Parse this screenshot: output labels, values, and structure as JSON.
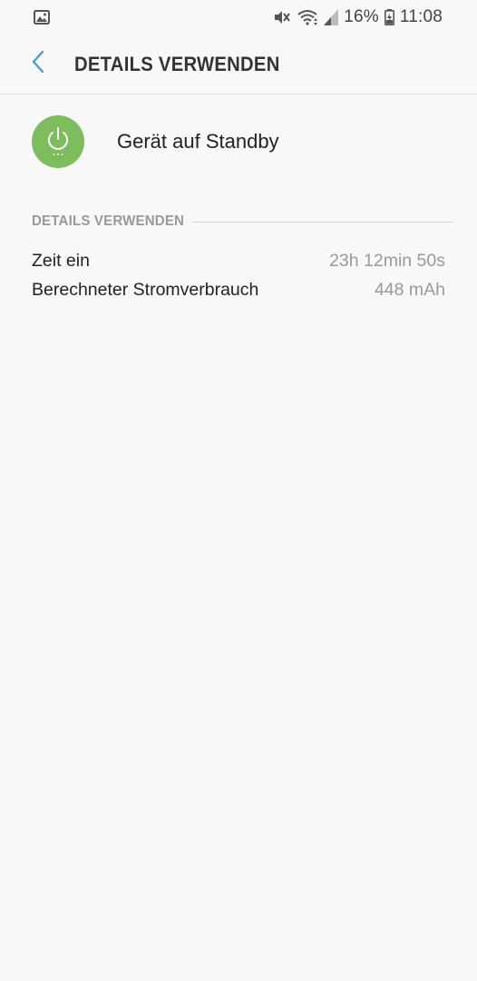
{
  "status_bar": {
    "battery_percent": "16%",
    "time": "11:08",
    "icons": [
      "image-icon",
      "mute-icon",
      "wifi-icon",
      "signal-icon",
      "battery-charging-icon"
    ]
  },
  "app_bar": {
    "title": "DETAILS VERWENDEN"
  },
  "app": {
    "name": "Gerät auf Standby",
    "icon": "power-icon",
    "icon_color": "#7dbd5e"
  },
  "section": {
    "title": "DETAILS VERWENDEN"
  },
  "details": [
    {
      "label": "Zeit ein",
      "value": "23h 12min 50s"
    },
    {
      "label": "Berechneter Stromverbrauch",
      "value": "448 mAh"
    }
  ],
  "colors": {
    "accent": "#4a9fc4",
    "background": "#f8f8f8",
    "secondary_text": "#9a9a9a"
  }
}
